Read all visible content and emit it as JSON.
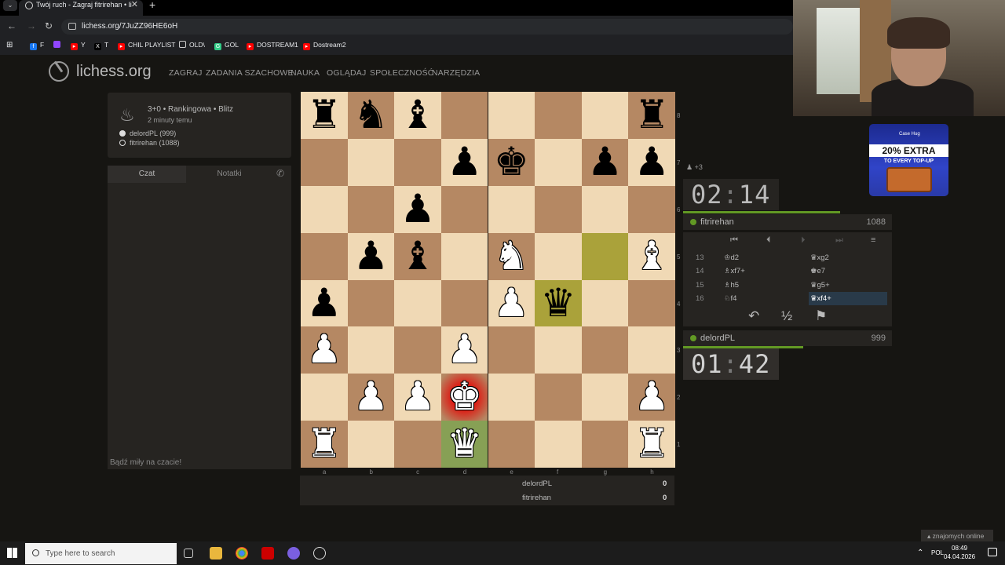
{
  "browser": {
    "tab_title": "Twój ruch - Zagraj fitrirehan • li",
    "url": "lichess.org/7JuZZ96HE6oH",
    "bookmarks": [
      "F",
      "Y",
      "T",
      "CHIL PLAYLIST",
      "OLD\\",
      "GOL",
      "DOSTREAM1",
      "Dostream2"
    ]
  },
  "site": {
    "brand": "lichess.org",
    "menu": [
      "ZAGRAJ",
      "ZADANIA SZACHOWE",
      "NAUKA",
      "OGLĄDAJ",
      "SPOŁECZNOŚĆ",
      "NARZĘDZIA"
    ]
  },
  "game": {
    "title": "3+0 • Rankingowa • Blitz",
    "ago": "2 minuty temu",
    "white_player": "delordPL (999)",
    "black_player": "fitrirehan (1088)"
  },
  "chat": {
    "tab_chat": "Czat",
    "tab_notes": "Notatki",
    "hint": "Bądź miły na czacie!"
  },
  "board": {
    "files": [
      "a",
      "b",
      "c",
      "d",
      "e",
      "f",
      "g",
      "h"
    ],
    "ranks": [
      "8",
      "7",
      "6",
      "5",
      "4",
      "3",
      "2",
      "1"
    ],
    "rows": [
      [
        "br",
        "bn",
        "bb",
        "",
        "",
        "",
        "",
        "br"
      ],
      [
        "",
        "",
        "",
        "bp",
        "bk",
        "",
        "bp",
        "bp"
      ],
      [
        "",
        "",
        "bp",
        "",
        "",
        "",
        "",
        ""
      ],
      [
        "",
        "bp",
        "bb",
        "",
        "wn",
        "",
        "",
        "wb"
      ],
      [
        "bp",
        "",
        "",
        "",
        "wp",
        "bq",
        "",
        ""
      ],
      [
        "wp",
        "",
        "",
        "wp",
        "",
        "",
        "",
        ""
      ],
      [
        "",
        "wp",
        "wp",
        "wk",
        "",
        "",
        "",
        "wp"
      ],
      [
        "wr",
        "",
        "",
        "wq",
        "",
        "",
        "",
        "wr"
      ]
    ]
  },
  "material": {
    "rows": [
      {
        "name": "delordPL",
        "value": "0"
      },
      {
        "name": "fitrirehan",
        "value": "0"
      }
    ]
  },
  "right": {
    "material_diff": "+3",
    "top_clock": {
      "min": "02",
      "sec": "14"
    },
    "top_player": {
      "name": "fitrirehan",
      "rating": "1088"
    },
    "bottom_player": {
      "name": "delordPL",
      "rating": "999"
    },
    "bottom_clock": {
      "min": "01",
      "sec": "42"
    },
    "moves": [
      {
        "n": "13",
        "w": "♔d2",
        "b": "♛xg2"
      },
      {
        "n": "14",
        "w": "♗xf7+",
        "b": "♚e7"
      },
      {
        "n": "15",
        "w": "♗h5",
        "b": "♛g5+"
      },
      {
        "n": "16",
        "w": "♘f4",
        "b": "♛xf4+"
      }
    ],
    "half": "½"
  },
  "ad": {
    "brand": "Case Hug",
    "headline": "20% EXTRA",
    "sub": "TO EVERY TOP-UP"
  },
  "online": "znajomych online",
  "taskbar": {
    "search": "Type here to search",
    "lang": "POL",
    "time": "08:49",
    "date": "04.04.2026"
  }
}
